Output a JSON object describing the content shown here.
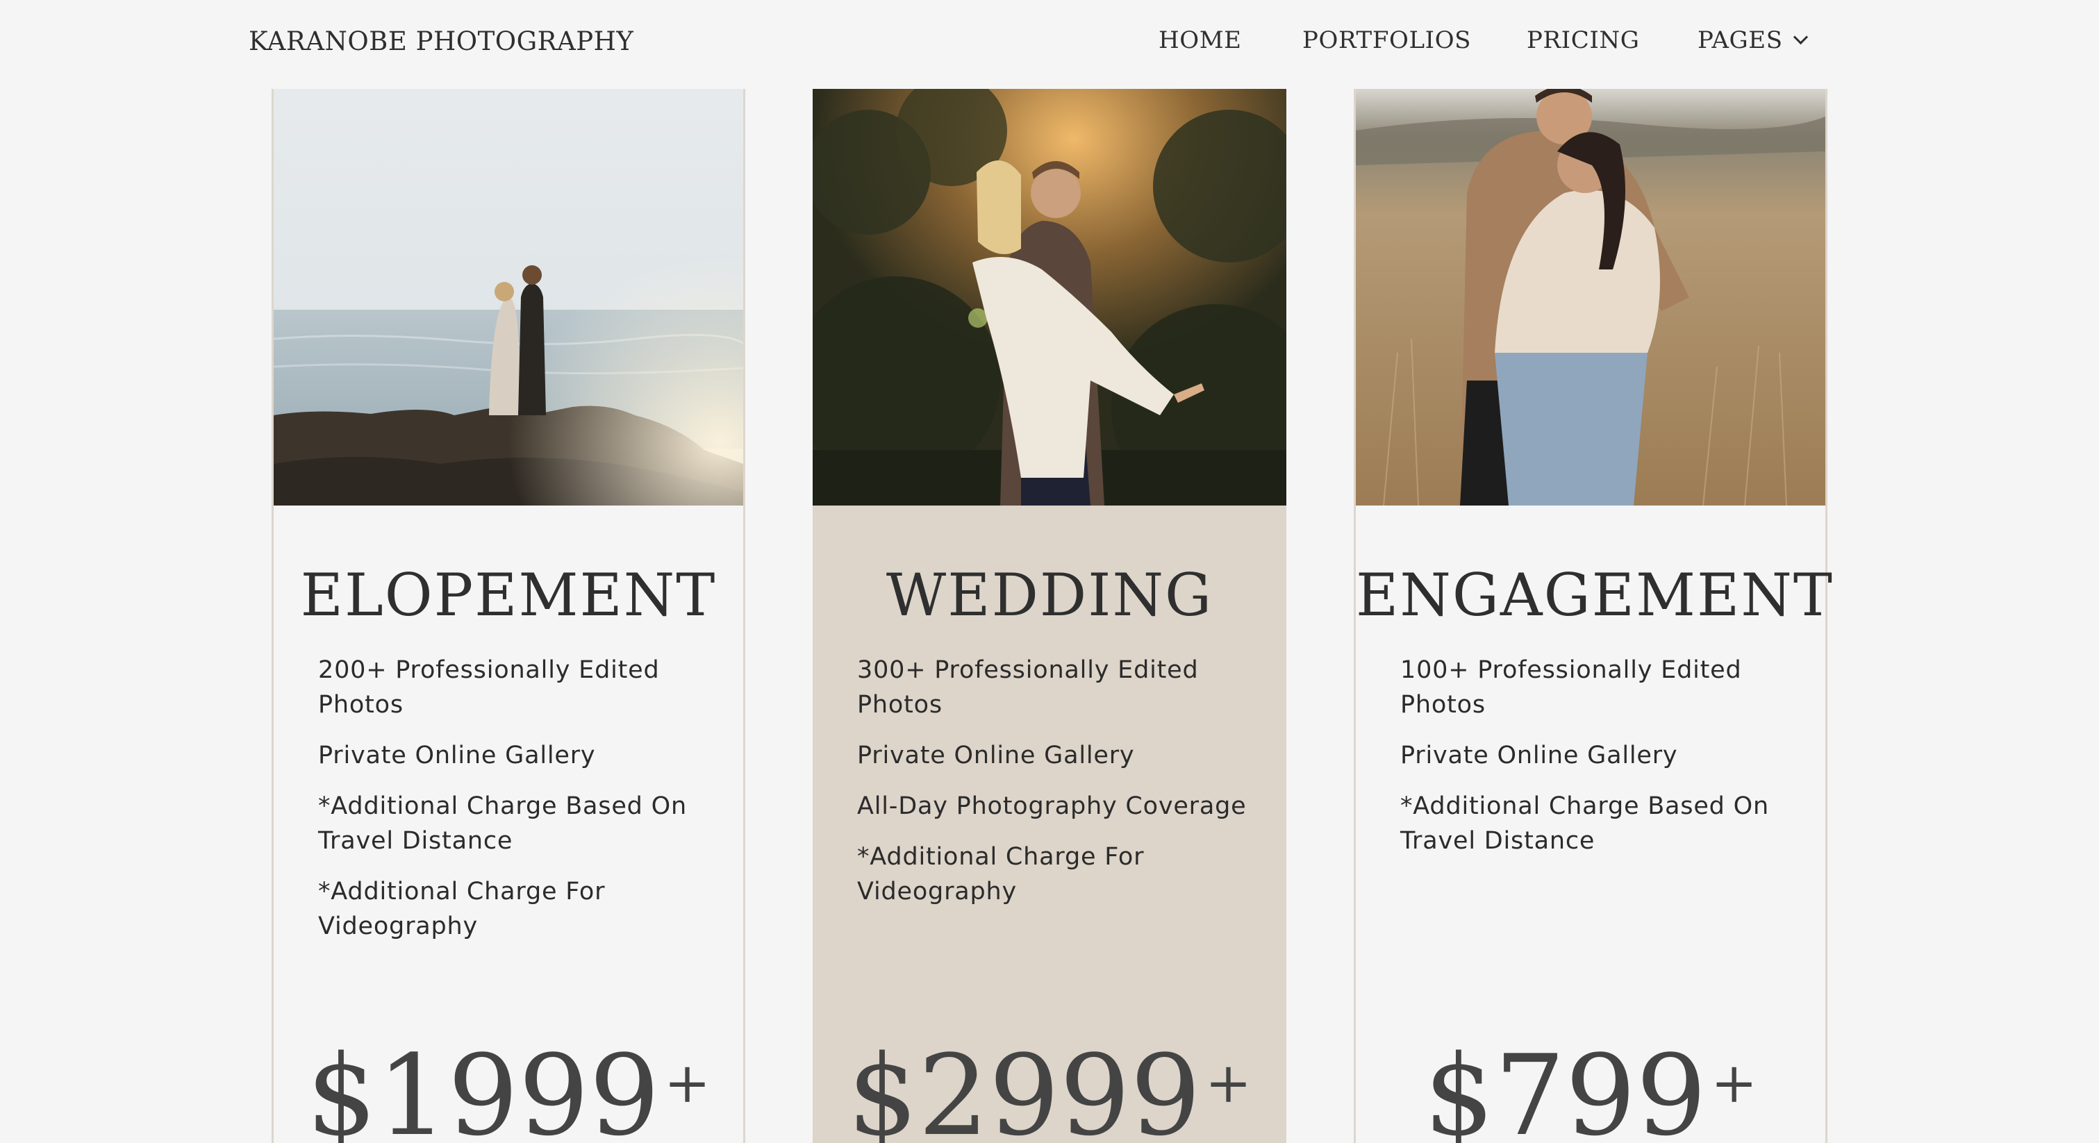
{
  "header": {
    "brand": "KARANOBE PHOTOGRAPHY",
    "nav": {
      "home": "HOME",
      "portfolios": "PORTFOLIOS",
      "pricing": "PRICING",
      "pages": "PAGES"
    }
  },
  "packages": [
    {
      "title": "ELOPEMENT",
      "features": [
        "200+ Professionally Edited Photos",
        "Private Online Gallery",
        "*Additional Charge Based On Travel Distance",
        "*Additional Charge For Videography"
      ],
      "price": "$1999",
      "price_suffix": "+"
    },
    {
      "title": "WEDDING",
      "features": [
        "300+ Professionally Edited Photos",
        "Private Online Gallery",
        "All-Day Photography Coverage",
        "*Additional Charge For Videography"
      ],
      "price": "$2999",
      "price_suffix": "+"
    },
    {
      "title": "ENGAGEMENT",
      "features": [
        "100+ Professionally Edited Photos",
        "Private Online Gallery",
        "*Additional Charge Based On Travel Distance"
      ],
      "price": "$799",
      "price_suffix": "+"
    }
  ],
  "colors": {
    "background": "#f5f5f5",
    "featured_card": "#ddd5ca",
    "card_border": "#dcd6ce",
    "text": "#2f2f2f"
  }
}
